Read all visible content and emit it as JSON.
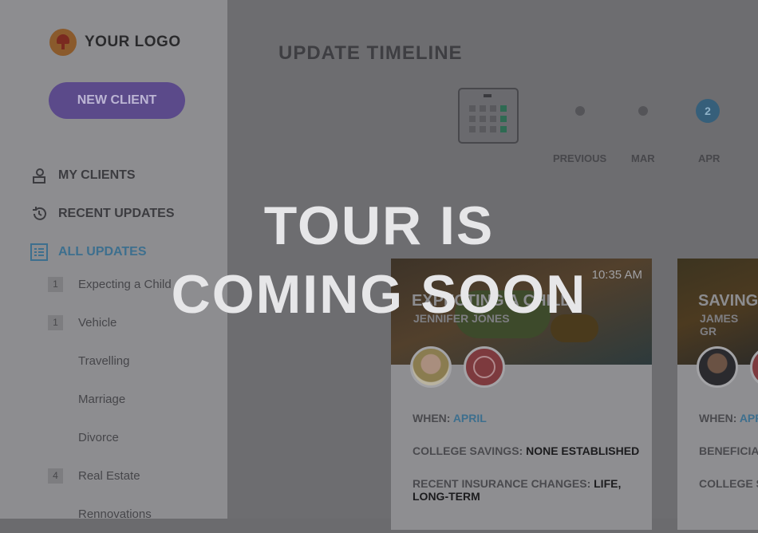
{
  "sidebar": {
    "logo_text": "YOUR LOGO",
    "new_client_label": "NEW CLIENT",
    "nav": [
      {
        "label": "MY CLIENTS",
        "icon": "clients-icon"
      },
      {
        "label": "RECENT UPDATES",
        "icon": "history-icon"
      },
      {
        "label": "ALL UPDATES",
        "icon": "list-icon",
        "active": true
      }
    ],
    "sub_items": [
      {
        "label": "Expecting a Child",
        "badge": "1"
      },
      {
        "label": "Vehicle",
        "badge": "1"
      },
      {
        "label": "Travelling",
        "badge": ""
      },
      {
        "label": "Marriage",
        "badge": ""
      },
      {
        "label": "Divorce",
        "badge": ""
      },
      {
        "label": "Real Estate",
        "badge": "4"
      },
      {
        "label": "Rennovations",
        "badge": ""
      }
    ]
  },
  "main": {
    "title": "UPDATE TIMELINE",
    "timeline": {
      "labels": [
        "PREVIOUS",
        "MAR",
        "APR"
      ],
      "active_count": "2"
    },
    "cards": [
      {
        "time": "10:35 AM",
        "title": "EXPECTING A CHILD",
        "client": "JENNIFER JONES",
        "when_label": "WHEN:",
        "when_value": "APRIL",
        "line2_label": "COLLEGE SAVINGS:",
        "line2_value": "NONE ESTABLISHED",
        "line3_label": "RECENT INSURANCE CHANGES:",
        "line3_value": "LIFE, LONG-TERM"
      },
      {
        "title": "SAVING",
        "client": "JAMES GR",
        "when_label": "WHEN:",
        "when_value": "APR",
        "line2_label": "BENEFICIA",
        "line3_label": "COLLEGE S"
      }
    ]
  },
  "overlay": {
    "line1": "TOUR IS",
    "line2": "COMING SOON"
  },
  "colors": {
    "accent_purple": "#7a5ce0",
    "accent_blue": "#3fa3e0",
    "overlay_text": "#e6e6e8"
  }
}
